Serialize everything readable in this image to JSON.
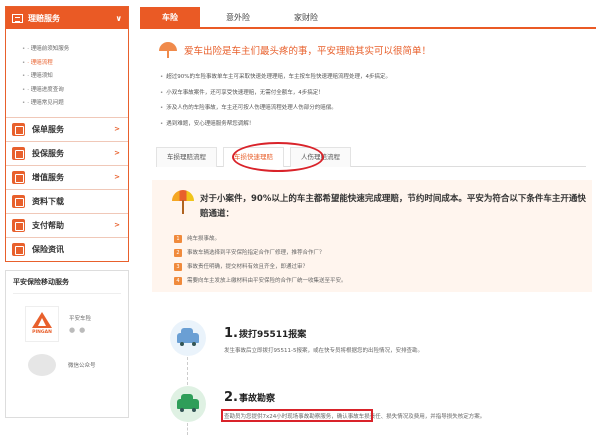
{
  "sidebar": {
    "header": "理赔服务",
    "header_arrow": "∨",
    "sub_items": [
      {
        "label": "· 理赔前须知服务",
        "active": false
      },
      {
        "label": "· 理赔流程",
        "active": true
      },
      {
        "label": "· 理赔须知",
        "active": false
      },
      {
        "label": "· 理赔进度查询",
        "active": false
      },
      {
        "label": "· 理赔常见问题",
        "active": false
      }
    ],
    "menu": [
      {
        "label": "保单服务",
        "icon": "policy-icon",
        "arrow": ">"
      },
      {
        "label": "投保服务",
        "icon": "insure-icon",
        "arrow": ">"
      },
      {
        "label": "增值服务",
        "icon": "gift-icon",
        "arrow": ">"
      },
      {
        "label": "资料下载",
        "icon": "download-icon",
        "arrow": ""
      },
      {
        "label": "支付帮助",
        "icon": "pay-icon",
        "arrow": ">"
      },
      {
        "label": "保险资讯",
        "icon": "news-icon",
        "arrow": ""
      }
    ],
    "mobile": {
      "title": "平安保险移动服务",
      "app_name": "平安车险",
      "app_logo_text": "PINGAN",
      "app_os": "",
      "wechat_name": "微信公众号"
    }
  },
  "top_tabs": [
    {
      "label": "车险",
      "active": true
    },
    {
      "label": "意外险",
      "active": false
    },
    {
      "label": "家财险",
      "active": false
    }
  ],
  "intro": {
    "title": "爱车出险是车主们最头疼的事，平安理赔其实可以很简单！",
    "lines": [
      "超过90%的车险事故单车主可采取快速处理理赔，车主按车险快速理赔流程处理，4步搞定。",
      "小双车事故案件，还可享受快速理赔，无需付全额车，4步搞定！",
      "涉及人伤的车险事故，车主还可按人伤理赔流程处理人伤部分的赔偿。",
      "遇到难题，安心理赔服务帮您调解！"
    ]
  },
  "claim_tabs": [
    {
      "label": "车损理赔流程",
      "active": false
    },
    {
      "label": "车损快速理赔",
      "active": true
    },
    {
      "label": "人伤理赔流程",
      "active": false
    }
  ],
  "notice": {
    "title": "对于小案件，90%以上的车主都希望能快速完成理赔，节约时间成本。平安为符合以下条件车主开通快赔通道：",
    "items": [
      {
        "num": "1",
        "text": "纯车损事故。"
      },
      {
        "num": "2",
        "text": "事故车辆选择到平安保险指定合作厂修理，推荐合作厂？"
      },
      {
        "num": "3",
        "text": "事故责任明确，提交材料有效且齐全，即通过审？"
      },
      {
        "num": "4",
        "text": "需要向车主发放上缴材料由平安保险的合作厂统一收集送至平安。"
      }
    ]
  },
  "steps": [
    {
      "num": "1.",
      "title": "拨打95511报案",
      "desc": "发生事故后立即拨打95511-5报案，或在快专员将根据您的出险情况，安排查勘。"
    },
    {
      "num": "2.",
      "title": "事故勘察",
      "desc": "查勘员为您提供7x24小时现场事故勘察服务，确认事故车损责任、损失情况及费用，并指导损失核定方案。"
    }
  ]
}
